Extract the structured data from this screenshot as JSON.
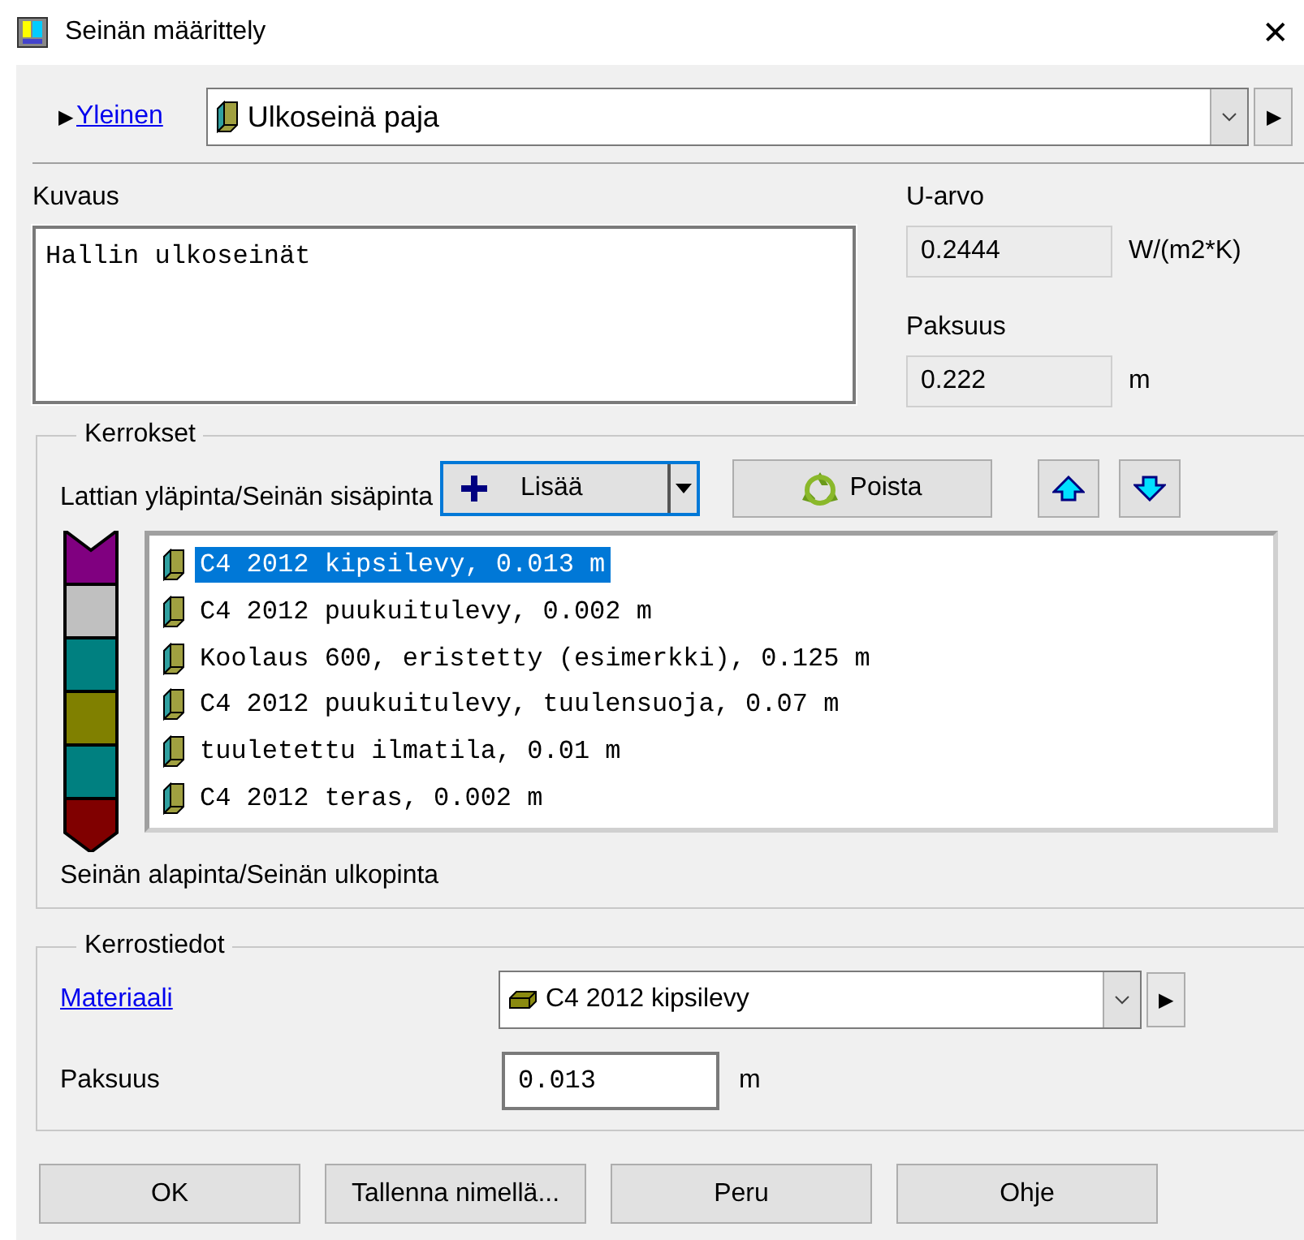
{
  "window": {
    "title": "Seinän määrittely",
    "close": "✕"
  },
  "header": {
    "expander": "▶",
    "link": "Yleinen",
    "structure": "Ulkoseinä paja",
    "next": "▶"
  },
  "description": {
    "label": "Kuvaus",
    "value": "Hallin ulkoseinät"
  },
  "u_value": {
    "label": "U-arvo",
    "value": "0.2444",
    "unit": "W/(m2*K)"
  },
  "thickness": {
    "label": "Paksuus",
    "value": "0.222",
    "unit": "m"
  },
  "layers": {
    "legend": "Kerrokset",
    "top_label": "Lattian yläpinta/Seinän sisäpinta",
    "bottom_label": "Seinän alapinta/Seinän ulkopinta",
    "add": "Lisää",
    "remove": "Poista",
    "items": [
      {
        "text": "C4 2012 kipsilevy, 0.013 m",
        "selected": true,
        "color": "#800080"
      },
      {
        "text": "C4 2012 puukuitulevy, 0.002 m",
        "selected": false,
        "color": "#c0c0c0"
      },
      {
        "text": "Koolaus 600, eristetty (esimerkki), 0.125 m",
        "selected": false,
        "color": "#008080"
      },
      {
        "text": "C4 2012 puukuitulevy, tuulensuoja, 0.07 m",
        "selected": false,
        "color": "#808000"
      },
      {
        "text": "tuuletettu ilmatila, 0.01 m",
        "selected": false,
        "color": "#008080"
      },
      {
        "text": "C4 2012 teras, 0.002 m",
        "selected": false,
        "color": "#800000"
      }
    ]
  },
  "layer_details": {
    "legend": "Kerrostiedot",
    "material_link": "Materiaali",
    "material": "C4 2012 kipsilevy",
    "next": "▶",
    "thickness_label": "Paksuus",
    "thickness": "0.013",
    "unit": "m"
  },
  "buttons": [
    "OK",
    "Tallenna nimellä...",
    "Peru",
    "Ohje"
  ]
}
